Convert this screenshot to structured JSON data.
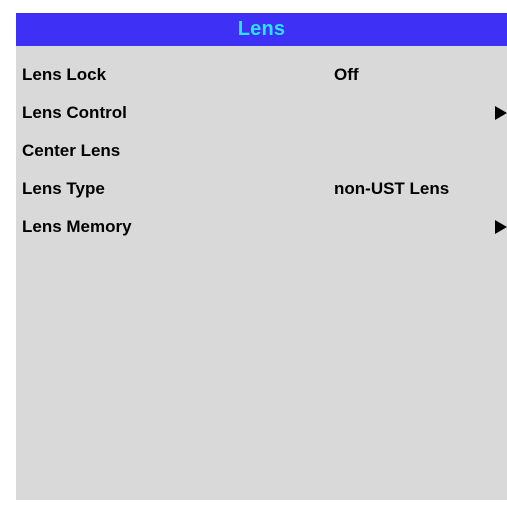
{
  "menu": {
    "title": "Lens",
    "items": [
      {
        "label": "Lens Lock",
        "value": "Off",
        "submenu": false
      },
      {
        "label": "Lens Control",
        "value": "",
        "submenu": true
      },
      {
        "label": "Center Lens",
        "value": "",
        "submenu": false
      },
      {
        "label": "Lens Type",
        "value": "non-UST Lens",
        "submenu": false
      },
      {
        "label": "Lens Memory",
        "value": "",
        "submenu": true
      }
    ]
  },
  "colors": {
    "title_bar": "#3f30f5",
    "title_text": "#29e4ff",
    "panel_background": "#d9d9d9",
    "item_text": "#000000"
  },
  "icons": {
    "submenu": "play-arrow-icon"
  }
}
